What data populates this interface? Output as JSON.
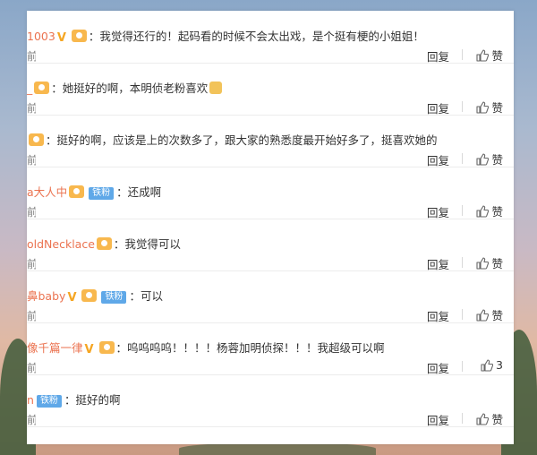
{
  "comments": [
    {
      "user": "1003",
      "v": true,
      "fan": true,
      "iron": "",
      "text": "：我觉得还行的！起码看的时候不会太出戏，是个挺有梗的小姐姐！",
      "emoji": false,
      "time": "前",
      "reply": "回复",
      "like": "赞"
    },
    {
      "user": "_",
      "v": false,
      "fan": true,
      "iron": "",
      "text": "：她挺好的啊，本明侦老粉喜欢",
      "emoji": true,
      "time": "前",
      "reply": "回复",
      "like": "赞"
    },
    {
      "user": "",
      "v": false,
      "fan": true,
      "iron": "",
      "text": "：挺好的啊，应该是上的次数多了，跟大家的熟悉度最开始好多了，挺喜欢她的",
      "emoji": false,
      "time": "前",
      "reply": "回复",
      "like": "赞"
    },
    {
      "user": "a大人中",
      "v": false,
      "fan": true,
      "iron": "铁粉",
      "text": "：还成啊",
      "emoji": false,
      "time": "前",
      "reply": "回复",
      "like": "赞"
    },
    {
      "user": "oldNecklace",
      "v": false,
      "fan": true,
      "iron": "",
      "text": "：我觉得可以",
      "emoji": false,
      "time": "前",
      "reply": "回复",
      "like": "赞"
    },
    {
      "user": "鼻baby",
      "v": true,
      "fan": true,
      "iron": "铁粉",
      "text": "：可以",
      "emoji": false,
      "time": "前",
      "reply": "回复",
      "like": "赞"
    },
    {
      "user": "像千篇一律",
      "v": true,
      "fan": true,
      "iron": "",
      "text": "：呜呜呜呜！！！！杨蓉加明侦探！！！我超级可以啊",
      "emoji": false,
      "time": "前",
      "reply": "回复",
      "like": "3"
    },
    {
      "user": "n",
      "v": false,
      "fan": false,
      "iron": "铁粉",
      "text": "：挺好的啊",
      "emoji": false,
      "time": "前",
      "reply": "回复",
      "like": "赞"
    }
  ],
  "colors": {
    "username": "#eb7350",
    "iron_badge": "#5fa8e8",
    "v_badge": "#f5a623"
  },
  "icons": {
    "like": "thumbs-up-icon",
    "v": "v-badge-icon",
    "fan": "fan-badge-icon"
  }
}
